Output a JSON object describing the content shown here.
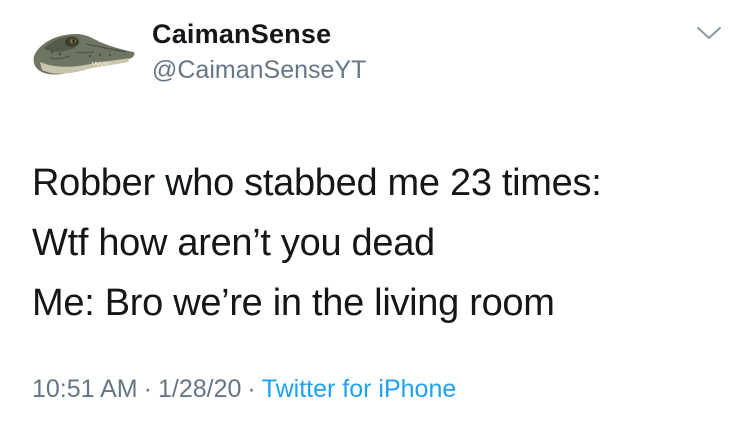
{
  "author": {
    "display_name": "CaimanSense",
    "handle": "@CaimanSenseYT",
    "avatar_icon": "caiman-avatar"
  },
  "menu": {
    "icon": "chevron-down-icon"
  },
  "tweet": {
    "lines": [
      "Robber who stabbed me 23 times:",
      "Wtf how aren’t you dead",
      "Me: Bro we’re in the living room"
    ]
  },
  "meta": {
    "time": "10:51 AM",
    "separator": "·",
    "date": "1/28/20",
    "source": "Twitter for iPhone"
  },
  "colors": {
    "text": "#14171a",
    "muted": "#657786",
    "link": "#1da1f2"
  }
}
